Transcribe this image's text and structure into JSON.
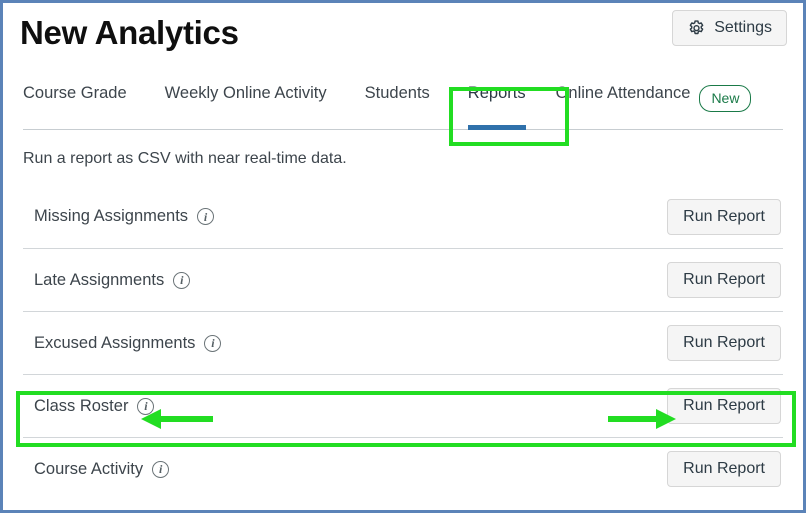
{
  "header": {
    "title": "New Analytics",
    "settings_label": "Settings",
    "settings_icon": "gear-icon"
  },
  "tabs": [
    {
      "label": "Course Grade",
      "active": false
    },
    {
      "label": "Weekly Online Activity",
      "active": false
    },
    {
      "label": "Students",
      "active": false
    },
    {
      "label": "Reports",
      "active": true
    },
    {
      "label": "Online Attendance",
      "active": false,
      "badge": "New"
    }
  ],
  "main": {
    "description": "Run a report as CSV with near real-time data.",
    "run_report_label": "Run Report",
    "info_icon_glyph": "i",
    "reports": [
      {
        "label": "Missing Assignments",
        "info_icon": "info-icon",
        "action": "Run Report"
      },
      {
        "label": "Late Assignments",
        "info_icon": "info-icon",
        "action": "Run Report"
      },
      {
        "label": "Excused Assignments",
        "info_icon": "info-icon",
        "action": "Run Report"
      },
      {
        "label": "Class Roster",
        "info_icon": "info-icon",
        "action": "Run Report",
        "highlighted": true
      },
      {
        "label": "Course Activity",
        "info_icon": "info-icon",
        "action": "Run Report"
      }
    ]
  },
  "annotations": {
    "highlight_color": "#22dd22",
    "highlight_targets": [
      "Reports",
      "Class Roster"
    ],
    "arrows": [
      {
        "name": "arrow-pointing-at-class-roster-info",
        "direction": "left"
      },
      {
        "name": "arrow-pointing-at-run-report-button",
        "direction": "right"
      }
    ]
  },
  "colors": {
    "frame_border": "#5b83b8",
    "active_tab_underline": "#2f71ab",
    "badge_green": "#1a7a48",
    "button_face": "#f5f5f5",
    "text": "#3d454c"
  }
}
